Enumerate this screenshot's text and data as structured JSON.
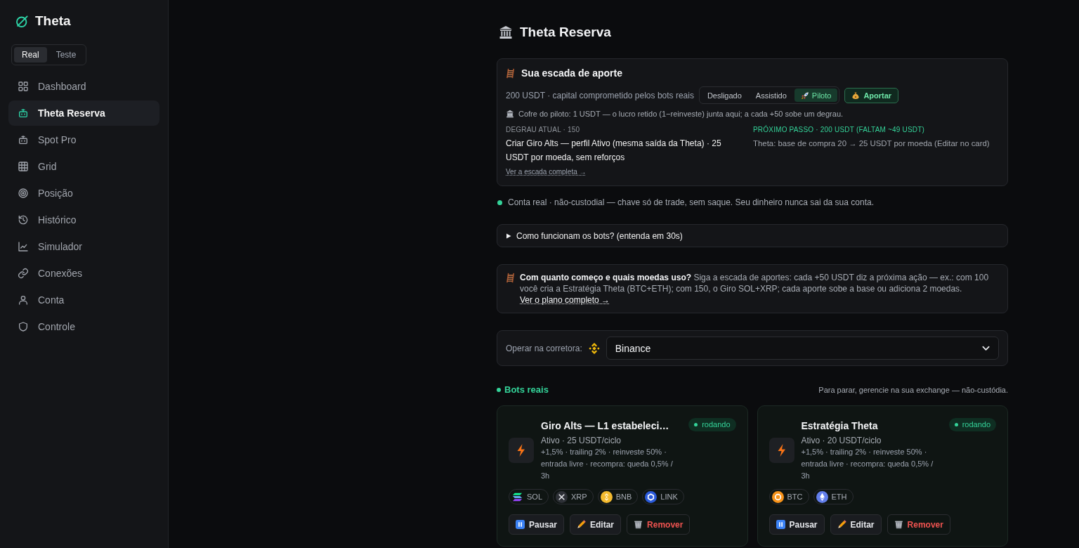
{
  "sidebar": {
    "brand": "Theta",
    "modes": [
      {
        "label": "Real",
        "selected": true
      },
      {
        "label": "Teste",
        "selected": false
      }
    ],
    "nav": [
      {
        "label": "Dashboard",
        "selected": false
      },
      {
        "label": "Theta Reserva",
        "selected": true
      },
      {
        "label": "Spot Pro",
        "selected": false
      },
      {
        "label": "Grid",
        "selected": false
      },
      {
        "label": "Posição",
        "selected": false
      },
      {
        "label": "Histórico",
        "selected": false
      },
      {
        "label": "Simulador",
        "selected": false
      },
      {
        "label": "Conexões",
        "selected": false
      },
      {
        "label": "Conta",
        "selected": false
      },
      {
        "label": "Controle",
        "selected": false
      }
    ]
  },
  "page": {
    "title": "Theta Reserva"
  },
  "ladder": {
    "title": "Sua escada de aporte",
    "capital": "200 USDT · capital comprometido pelos bots reais",
    "pilot_modes": [
      {
        "label": "Desligado",
        "selected": false
      },
      {
        "label": "Assistido",
        "selected": false
      },
      {
        "label": "Piloto",
        "selected": true
      }
    ],
    "contribute_button": "Aportar",
    "vault_note": "Cofre do piloto: 1 USDT — o lucro retido (1−reinveste) junta aqui; a cada +50 sobe um degrau.",
    "current_step": {
      "label": "DEGRAU ATUAL · 150",
      "text": "Criar Giro Alts — perfil Ativo (mesma saída da Theta) · 25 USDT por moeda, sem reforços",
      "link": "Ver a escada completa →"
    },
    "next_step": {
      "label": "PRÓXIMO PASSO · 200 USDT (FALTAM ~49 USDT)",
      "text": "Theta: base de compra 20 → 25 USDT por moeda (Editar no card)"
    }
  },
  "account_notice": "Conta real · não-custodial — chave só de trade, sem saque. Seu dinheiro nunca sai da sua conta.",
  "faq": {
    "summary": "Como funcionam os bots? (entenda em 30s)",
    "expanded": false
  },
  "tip": {
    "text": "**Com quanto começo e quais moedas uso?** Siga a escada de aportes: cada +50 USDT diz a próxima ação — ex.: com 100 você cria a Estratégia Theta (BTC+ETH); com 150, o Giro SOL+XRP; cada aporte sobe a base ou adiciona 2 moedas.",
    "link": "Ver o plano completo →"
  },
  "exchange": {
    "label": "Operar na corretora:",
    "value": "Binance"
  },
  "bots_section": {
    "title": "Bots reais",
    "note": "Para parar, gerencie na sua exchange — não-custódia."
  },
  "bots": [
    {
      "name": "Giro Alts — L1 estabeleci…",
      "status": "rodando",
      "summary": "Ativo · 25 USDT/ciclo",
      "details": "+1,5% · trailing 2% · reinveste 50% · entrada livre · recompra: queda 0,5% / 3h",
      "coins": [
        {
          "symbol": "SOL",
          "kind": "sol"
        },
        {
          "symbol": "XRP",
          "kind": "xrp"
        },
        {
          "symbol": "BNB",
          "kind": "bnb"
        },
        {
          "symbol": "LINK",
          "kind": "link"
        }
      ],
      "actions": [
        {
          "label": "Pausar",
          "kind": "pause"
        },
        {
          "label": "Editar",
          "kind": "edit"
        },
        {
          "label": "Remover",
          "kind": "remove"
        }
      ]
    },
    {
      "name": "Estratégia Theta",
      "status": "rodando",
      "summary": "Ativo · 20 USDT/ciclo",
      "details": "+1,5% · trailing 2% · reinveste 50% · entrada livre · recompra: queda 0,5% / 3h",
      "coins": [
        {
          "symbol": "BTC",
          "kind": "btc"
        },
        {
          "symbol": "ETH",
          "kind": "eth"
        }
      ],
      "actions": [
        {
          "label": "Pausar",
          "kind": "pause"
        },
        {
          "label": "Editar",
          "kind": "edit"
        },
        {
          "label": "Remover",
          "kind": "remove"
        }
      ]
    }
  ]
}
